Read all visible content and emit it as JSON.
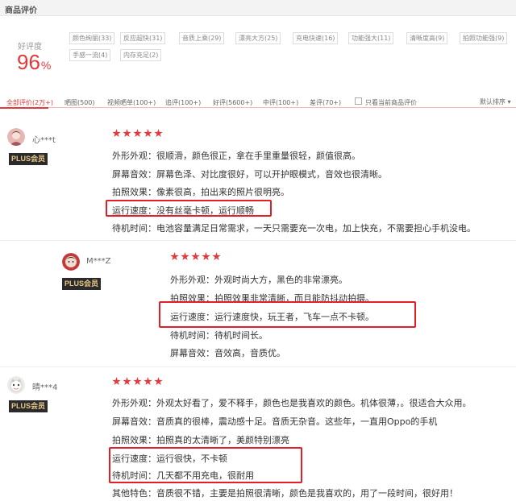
{
  "header": {
    "title": "商品评价"
  },
  "rating": {
    "label": "好评度",
    "value": "96",
    "unit": "%"
  },
  "tags": [
    "颜色绚丽(33)",
    "反应超快(31)",
    "音质上乘(29)",
    "漂亮大方(25)",
    "充电快速(16)",
    "功能强大(11)",
    "清晰度高(9)",
    "拍照功能强(9)",
    "手感一流(4)",
    "内存充足(2)"
  ],
  "filters": {
    "items": [
      "全部评价(2万+)",
      "晒图(500)",
      "视频晒单(100+)",
      "追评(100+)",
      "好评(5600+)",
      "中评(100+)",
      "差评(70+)"
    ],
    "checkbox_label": "只看当前商品评价",
    "sort_label": "默认排序 ▾"
  },
  "reviews": [
    {
      "user": "心***t",
      "badge": "PLUS会员",
      "lines": [
        "外形外观：很顺滑，颜色很正，拿在手里重量很轻，颜值很高。",
        "屏幕音效：屏幕色泽、对比度很好，可以开护眼模式，音效也很清晰。",
        "拍照效果：像素很高，拍出来的照片很明亮。",
        "运行速度：没有丝毫卡顿，运行顺畅",
        "待机时间：电池容量满足日常需求，一天只需要充一次电，加上快充，不需要担心手机没电。"
      ]
    },
    {
      "user": "M***Z",
      "badge": "PLUS会员",
      "lines": [
        "外形外观：外观时尚大方，黑色的非常漂亮。",
        "拍照效果：拍照效果非常清晰，而且能防抖动拍摄。",
        "运行速度：运行速度快，玩王者，飞车一点不卡顿。",
        "待机时间：待机时间长。",
        "屏幕音效：音效高，音质优。"
      ]
    },
    {
      "user": "晴***4",
      "badge": "PLUS会员",
      "lines": [
        "外形外观：外观太好看了，爱不释手，颜色也是我喜欢的颜色。机体很薄，。很适合大众用。",
        "屏幕音效：音质真的很棒，震动感十足。音质无杂音。这些年，一直用Oppo的手机",
        "拍照效果：拍照真的太清晰了，美颜特别漂亮",
        "运行速度：运行很快，不卡顿",
        "待机时间：几天都不用充电，很耐用",
        "其他特色：音质很不错，主要是拍照很清晰，颜色是我喜欢的，用了一段时间，很好用！"
      ]
    }
  ],
  "colors": {
    "accent": "#e4393c",
    "highlight_box": "#e31e24",
    "plus_bg": "#2b2b2b",
    "plus_text": "#e8c887"
  }
}
